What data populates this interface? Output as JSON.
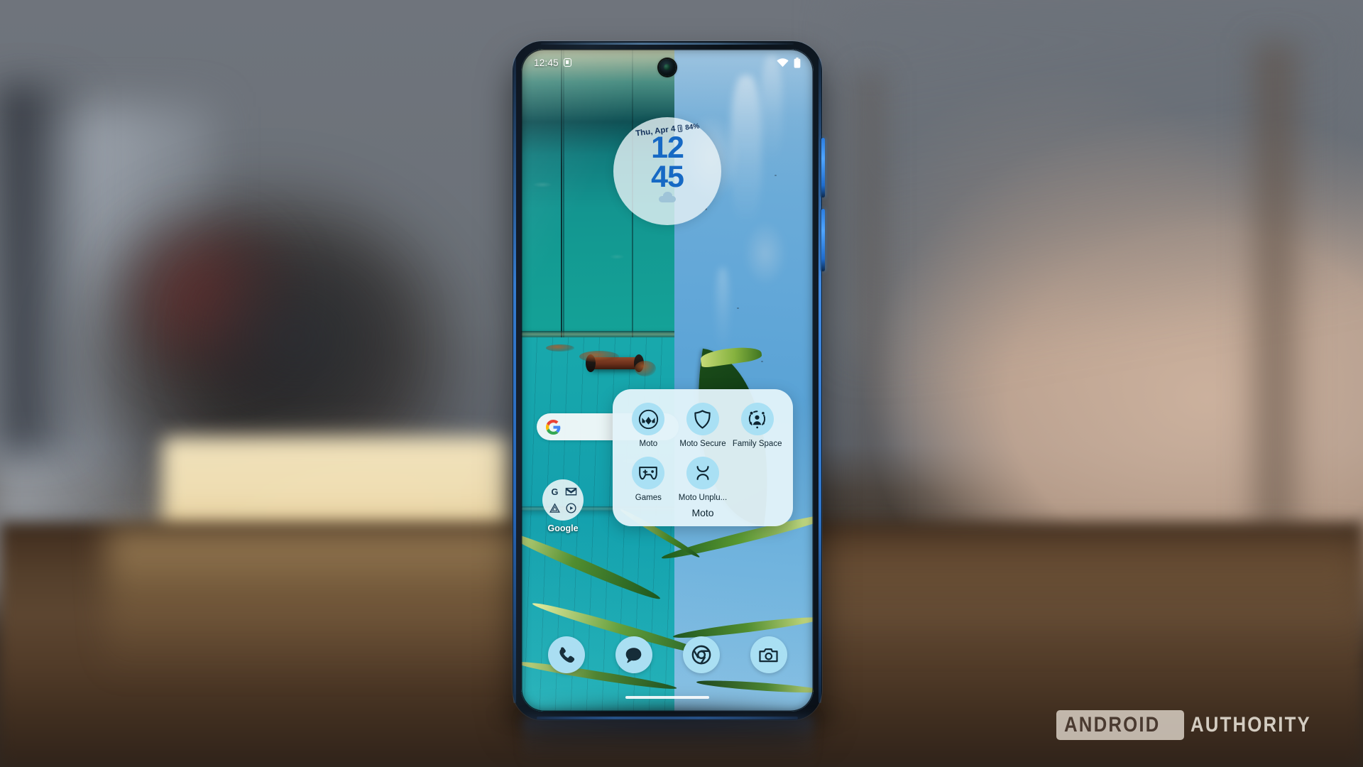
{
  "scene": {
    "description": "Motorola smartphone standing upright on a dark wooden table, blurred living-room background",
    "colors": {
      "wall": "#6b7178",
      "table": "#55402c",
      "phone_edge_accent": "#3d8bea",
      "folder_bg": "#e2f2f9",
      "app_icon_bg": "#a9e0f4",
      "icon_stroke": "#0d2430",
      "clock_digit": "#1669c4"
    }
  },
  "phone": {
    "statusbar": {
      "time": "12:45",
      "cast_icon": "screen-cast-icon",
      "wifi_icon": "wifi-icon",
      "battery_icon": "battery-icon"
    },
    "clock_widget": {
      "date": "Thu, Apr 4",
      "battery_percent": "84%",
      "hours": "12",
      "minutes": "45",
      "weather_icon": "cloud-icon"
    },
    "search_pill": {
      "icon": "google-g-icon",
      "placeholder": ""
    },
    "google_folder": {
      "label": "Google",
      "mini_icons": [
        {
          "name": "google-search-icon",
          "glyph": "G"
        },
        {
          "name": "gmail-icon",
          "glyph": "M"
        },
        {
          "name": "google-drive-icon",
          "glyph": "drive"
        },
        {
          "name": "youtube-music-icon",
          "glyph": "play"
        }
      ]
    },
    "folder_popup": {
      "folder_name": "Moto",
      "apps": [
        {
          "label": "Moto",
          "icon": "motorola-batwing-icon"
        },
        {
          "label": "Moto Secure",
          "icon": "shield-icon"
        },
        {
          "label": "Family Space",
          "icon": "family-space-icon"
        },
        {
          "label": "Games",
          "icon": "gamepad-icon"
        },
        {
          "label": "Moto Unplu...",
          "icon": "moto-unplugged-icon"
        }
      ]
    },
    "dock": [
      {
        "label": "Phone",
        "icon": "phone-handset-icon"
      },
      {
        "label": "Messages",
        "icon": "message-bubble-icon"
      },
      {
        "label": "Chrome",
        "icon": "chrome-icon"
      },
      {
        "label": "Camera",
        "icon": "camera-icon"
      }
    ],
    "nav": {
      "gesture_pill": "home-gesture-pill"
    },
    "side_buttons": [
      {
        "name": "volume-rocker"
      },
      {
        "name": "power-button"
      }
    ]
  },
  "watermark": {
    "boxed_word": "ANDROID",
    "plain_word": "AUTHORITY"
  }
}
